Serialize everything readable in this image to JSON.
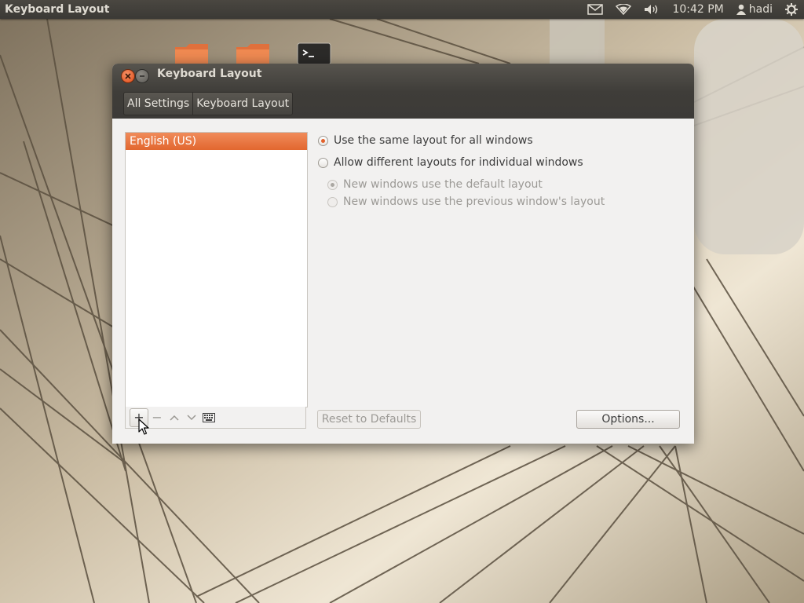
{
  "panel": {
    "app_title": "Keyboard Layout",
    "clock": "10:42 PM",
    "user": "hadi",
    "icons": [
      "mail-icon",
      "wifi-icon",
      "volume-icon",
      "user-icon",
      "gear-icon"
    ]
  },
  "desktop": {
    "icons": [
      "folder-icon",
      "folder-icon",
      "terminal-icon"
    ]
  },
  "window": {
    "title": "Keyboard Layout",
    "breadcrumb": [
      "All Settings",
      "Keyboard Layout"
    ],
    "layouts": [
      "English (US)"
    ],
    "selected_layout": "English (US)",
    "list_toolbar": {
      "add": "+",
      "remove": "−",
      "up": "˄",
      "down": "˅"
    },
    "options": {
      "same_layout": "Use the same layout for all windows",
      "different_layouts": "Allow different layouts for individual windows",
      "new_default": "New windows use the default layout",
      "new_previous": "New windows use the previous window's layout"
    },
    "buttons": {
      "reset": "Reset to Defaults",
      "options": "Options..."
    }
  },
  "colors": {
    "accent": "#e2672f",
    "panel": "#3c3b37"
  }
}
